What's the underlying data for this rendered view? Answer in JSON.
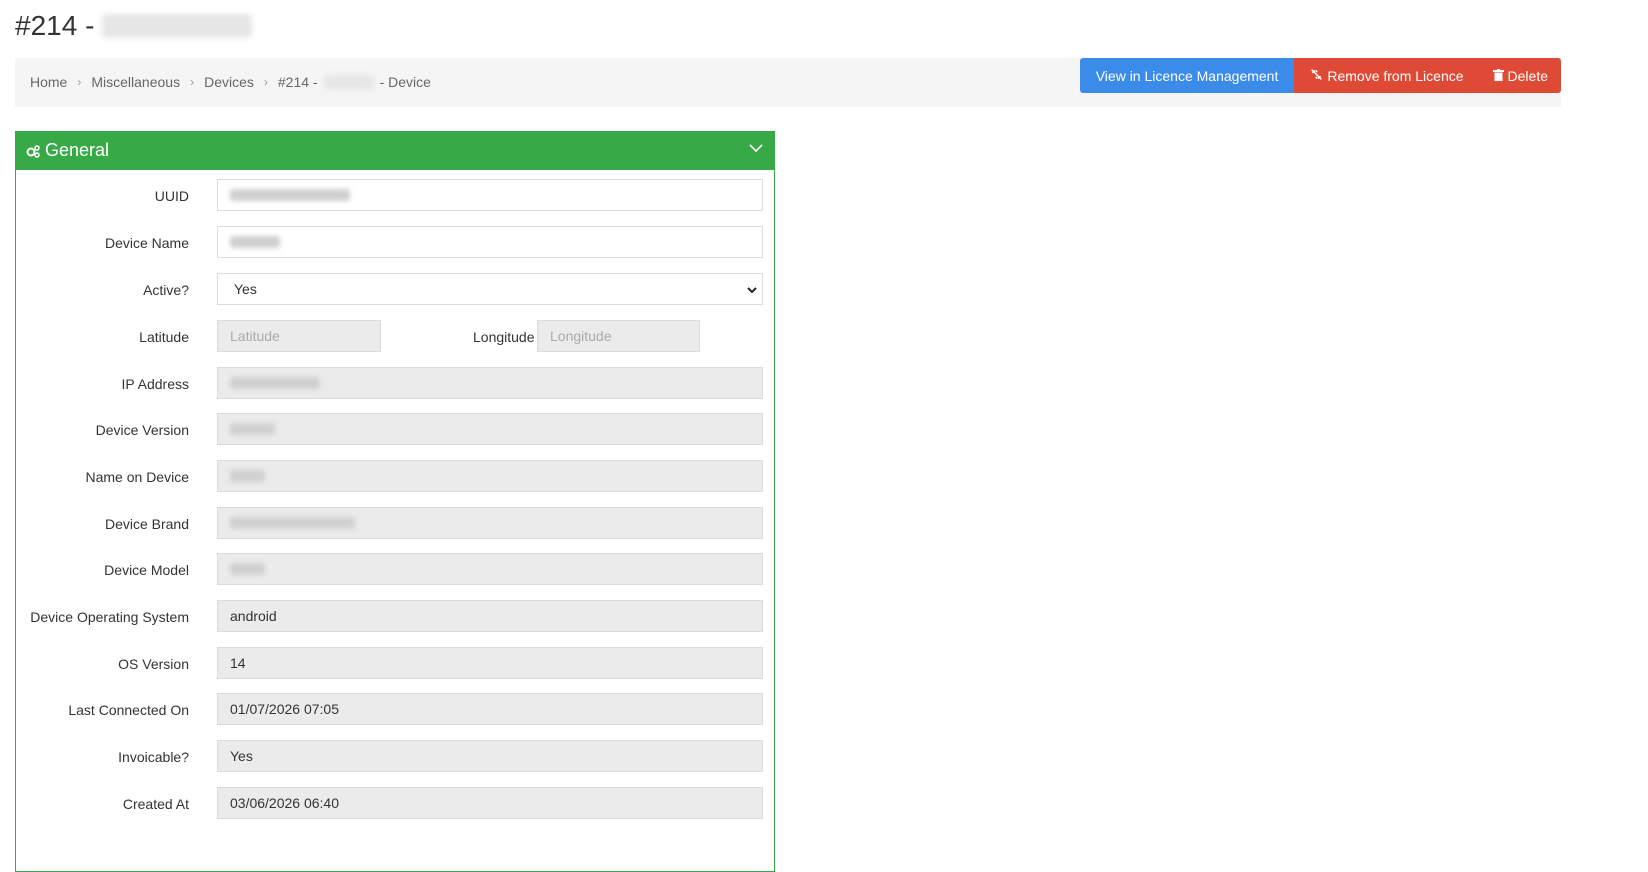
{
  "title": {
    "prefix": "#214 -"
  },
  "breadcrumb": {
    "items": [
      "Home",
      "Miscellaneous",
      "Devices"
    ],
    "current_prefix": "#214 -",
    "current_suffix": "- Device"
  },
  "actions": {
    "view_licence": "View in Licence Management",
    "remove_licence": "Remove from Licence",
    "delete": "Delete"
  },
  "panel": {
    "title": "General"
  },
  "fields": {
    "uuid": {
      "label": "UUID"
    },
    "device_name": {
      "label": "Device Name"
    },
    "active": {
      "label": "Active?",
      "value": "Yes"
    },
    "latitude": {
      "label": "Latitude",
      "placeholder": "Latitude"
    },
    "longitude": {
      "label": "Longitude",
      "placeholder": "Longitude"
    },
    "ip_address": {
      "label": "IP Address"
    },
    "device_version": {
      "label": "Device Version"
    },
    "name_on_device": {
      "label": "Name on Device"
    },
    "device_brand": {
      "label": "Device Brand"
    },
    "device_model": {
      "label": "Device Model"
    },
    "device_os": {
      "label": "Device Operating System",
      "value": "android"
    },
    "os_version": {
      "label": "OS Version",
      "value": "14"
    },
    "last_connected": {
      "label": "Last Connected On",
      "value": "01/07/2026 07:05"
    },
    "invoicable": {
      "label": "Invoicable?",
      "value": "Yes"
    },
    "created_at": {
      "label": "Created At",
      "value": "03/06/2026 06:40"
    }
  },
  "colors": {
    "primary": "#3b8beb",
    "danger": "#df4a36",
    "success": "#38a947"
  }
}
